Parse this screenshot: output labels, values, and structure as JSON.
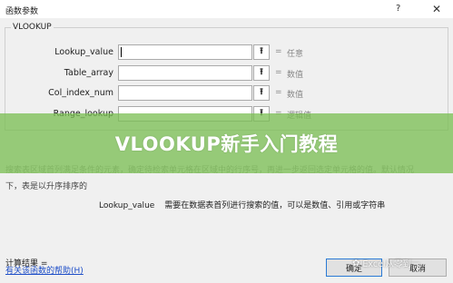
{
  "window": {
    "title": "函数参数",
    "help_glyph": "?",
    "close_glyph": "✕"
  },
  "group": {
    "title": "VLOOKUP"
  },
  "args": [
    {
      "label": "Lookup_value",
      "value": "",
      "eq": "=",
      "hint": "任意"
    },
    {
      "label": "Table_array",
      "value": "",
      "eq": "=",
      "hint": "数值"
    },
    {
      "label": "Col_index_num",
      "value": "",
      "eq": "=",
      "hint": "数值"
    },
    {
      "label": "Range_lookup",
      "value": "",
      "eq": "=",
      "hint": "逻辑值"
    }
  ],
  "ref_glyph": "⭱",
  "banner": {
    "text": "VLOOKUP新手入门教程"
  },
  "description": {
    "line1": "搜索表区域首列满足条件的元素，确定待检索单元格在区域中的行序号，再进一步返回选定单元格的值。默认情况",
    "line2": "下，表是以升序排序的"
  },
  "arg_description": {
    "name": "Lookup_value",
    "text": "需要在数据表首列进行搜索的值，可以是数值、引用或字符串"
  },
  "result": {
    "label": "计算结果 ="
  },
  "help_link": "有关该函数的帮助(H)",
  "buttons": {
    "ok": "确定",
    "cancel": "取消"
  },
  "watermark": {
    "text": "Excel从零到一"
  }
}
